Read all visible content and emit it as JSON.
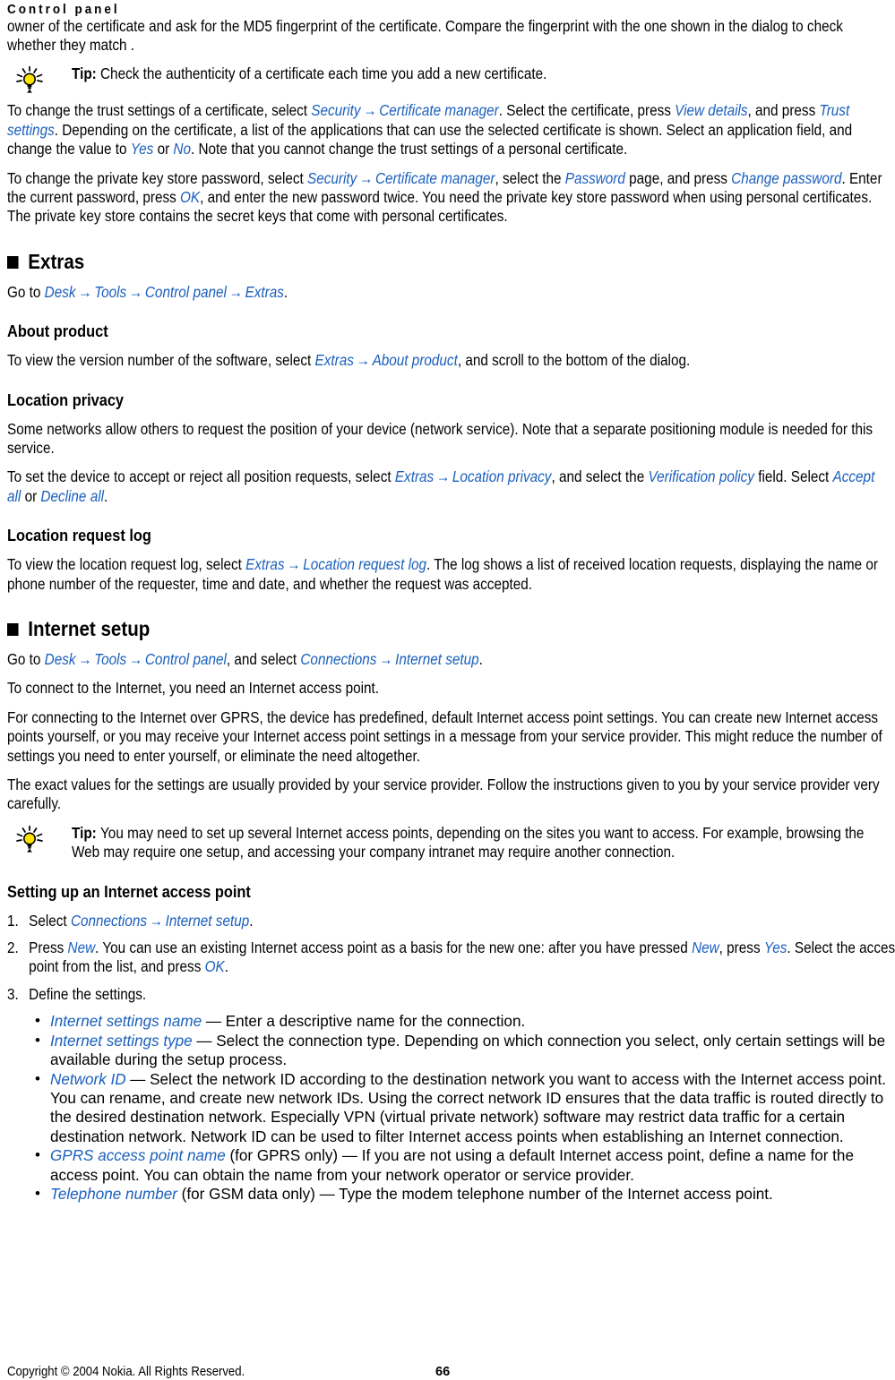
{
  "header": {
    "running_title": "Control panel"
  },
  "icons": {
    "tip_bulb": "lightbulb-icon",
    "section_bullet": "black-square-bullet",
    "arrow": "→",
    "list_bullet": "•"
  },
  "colors": {
    "link_blue": "#1a5fbd",
    "text_black": "#000000",
    "bulb_yellow": "#ffe400",
    "page_background": "#ffffff"
  },
  "content": [
    {
      "id": "para-cert-continued",
      "type": "paragraph",
      "runs": [
        {
          "t": "owner of the certificate and ask for the MD5 fingerprint of the certificate. Compare the fingerprint with the one shown in the dialog to check whether they match ."
        }
      ]
    },
    {
      "id": "tip-certificate-authenticity",
      "type": "tip",
      "label": "Tip:",
      "text": "Check the authenticity of a certificate each time you add a new certificate."
    },
    {
      "id": "para-trust-settings",
      "type": "paragraph",
      "runs": [
        {
          "t": "To change the trust settings of a certificate, select "
        },
        {
          "t": "Security",
          "s": "ui"
        },
        {
          "t": "→",
          "s": "arrow"
        },
        {
          "t": "Certificate manager",
          "s": "ui"
        },
        {
          "t": ". Select the certificate, press "
        },
        {
          "t": "View details",
          "s": "ui"
        },
        {
          "t": ", and press "
        },
        {
          "t": "Trust settings",
          "s": "ui"
        },
        {
          "t": ". Depending on the certificate, a list of the applications that can use the selected certificate is shown. Select an application field, and change the value to "
        },
        {
          "t": "Yes",
          "s": "ui"
        },
        {
          "t": " or "
        },
        {
          "t": "No",
          "s": "ui"
        },
        {
          "t": ". Note that you cannot change the trust settings of a personal certificate."
        }
      ]
    },
    {
      "id": "para-private-key-store",
      "type": "paragraph",
      "runs": [
        {
          "t": "To change the private key store password, select "
        },
        {
          "t": "Security",
          "s": "ui"
        },
        {
          "t": "→",
          "s": "arrow"
        },
        {
          "t": "Certificate manager",
          "s": "ui"
        },
        {
          "t": ", select the "
        },
        {
          "t": "Password",
          "s": "ui"
        },
        {
          "t": " page, and press "
        },
        {
          "t": "Change password",
          "s": "ui"
        },
        {
          "t": ". Enter the current password, press "
        },
        {
          "t": "OK",
          "s": "ui"
        },
        {
          "t": ", and enter the new password twice. You need the private key store password when using personal certificates. The private key store contains the secret keys that come with personal certificates."
        }
      ]
    },
    {
      "id": "heading-extras",
      "type": "section-heading",
      "text": "Extras"
    },
    {
      "id": "para-goto-extras",
      "type": "paragraph",
      "runs": [
        {
          "t": "Go to "
        },
        {
          "t": "Desk",
          "s": "ui"
        },
        {
          "t": "→",
          "s": "arrow"
        },
        {
          "t": "Tools",
          "s": "ui"
        },
        {
          "t": "→",
          "s": "arrow"
        },
        {
          "t": "Control panel",
          "s": "ui"
        },
        {
          "t": "→",
          "s": "arrow"
        },
        {
          "t": "Extras",
          "s": "ui"
        },
        {
          "t": "."
        }
      ]
    },
    {
      "id": "heading-about-product",
      "type": "sub-heading",
      "text": "About product"
    },
    {
      "id": "para-about-product",
      "type": "paragraph",
      "runs": [
        {
          "t": "To view the version number of the software, select "
        },
        {
          "t": "Extras",
          "s": "ui"
        },
        {
          "t": "→",
          "s": "arrow"
        },
        {
          "t": "About product",
          "s": "ui"
        },
        {
          "t": ", and scroll to the bottom of the dialog."
        }
      ]
    },
    {
      "id": "heading-location-privacy",
      "type": "sub-heading",
      "text": "Location privacy"
    },
    {
      "id": "para-location-privacy-intro",
      "type": "paragraph",
      "runs": [
        {
          "t": "Some networks allow others to request the position of your device (network service). Note that a separate positioning module is needed for this service."
        }
      ]
    },
    {
      "id": "para-location-privacy-set",
      "type": "paragraph",
      "runs": [
        {
          "t": "To set the device to accept or reject all position requests, select "
        },
        {
          "t": "Extras",
          "s": "ui"
        },
        {
          "t": "→",
          "s": "arrow"
        },
        {
          "t": "Location privacy",
          "s": "ui"
        },
        {
          "t": ", and select the "
        },
        {
          "t": "Verification policy",
          "s": "ui"
        },
        {
          "t": " field. Select "
        },
        {
          "t": "Accept all",
          "s": "ui"
        },
        {
          "t": " or "
        },
        {
          "t": "Decline all",
          "s": "ui"
        },
        {
          "t": "."
        }
      ]
    },
    {
      "id": "heading-location-request-log",
      "type": "sub-heading",
      "text": "Location request log"
    },
    {
      "id": "para-location-request-log",
      "type": "paragraph",
      "runs": [
        {
          "t": "To view the location request log, select "
        },
        {
          "t": "Extras",
          "s": "ui"
        },
        {
          "t": "→",
          "s": "arrow"
        },
        {
          "t": "Location request log",
          "s": "ui"
        },
        {
          "t": ". The log shows a list of received location requests, displaying the name or phone number of the requester, time and date, and whether the request was accepted."
        }
      ]
    },
    {
      "id": "heading-internet-setup",
      "type": "section-heading",
      "text": "Internet setup"
    },
    {
      "id": "para-goto-internet-setup",
      "type": "paragraph",
      "runs": [
        {
          "t": "Go to "
        },
        {
          "t": "Desk",
          "s": "ui"
        },
        {
          "t": "→",
          "s": "arrow"
        },
        {
          "t": "Tools",
          "s": "ui"
        },
        {
          "t": "→",
          "s": "arrow"
        },
        {
          "t": "Control panel",
          "s": "ui"
        },
        {
          "t": ", and select "
        },
        {
          "t": "Connections",
          "s": "ui"
        },
        {
          "t": "→",
          "s": "arrow"
        },
        {
          "t": "Internet setup",
          "s": "ui"
        },
        {
          "t": "."
        }
      ]
    },
    {
      "id": "para-need-access-point",
      "type": "paragraph",
      "runs": [
        {
          "t": "To connect to the Internet, you need an Internet access point."
        }
      ]
    },
    {
      "id": "para-gprs-predefined",
      "type": "paragraph",
      "runs": [
        {
          "t": "For connecting to the Internet over GPRS, the device has predefined, default Internet access point settings. You can create new Internet access points yourself, or you may receive your Internet access point settings in a message from your service provider. This might reduce the number of settings you need to enter yourself, or eliminate the need altogether."
        }
      ]
    },
    {
      "id": "para-exact-values",
      "type": "paragraph",
      "runs": [
        {
          "t": "The exact values for the settings are usually provided by your service provider. Follow the instructions given to you by your service provider very carefully."
        }
      ]
    },
    {
      "id": "tip-several-access-points",
      "type": "tip",
      "label": "Tip:",
      "text": "You may need to set up several Internet access points, depending on the sites you want to access. For example, browsing the Web may require one setup, and accessing your company intranet may require another connection."
    },
    {
      "id": "heading-setting-up-iap",
      "type": "sub-heading",
      "text": "Setting up an Internet access point"
    }
  ],
  "steps": [
    {
      "id": "step-1",
      "num": "1.",
      "runs": [
        {
          "t": "Select "
        },
        {
          "t": "Connections",
          "s": "ui"
        },
        {
          "t": "→",
          "s": "arrow"
        },
        {
          "t": "Internet setup",
          "s": "ui"
        },
        {
          "t": "."
        }
      ]
    },
    {
      "id": "step-2",
      "num": "2.",
      "runs": [
        {
          "t": "Press "
        },
        {
          "t": "New",
          "s": "ui"
        },
        {
          "t": ". You can use an existing Internet access point as a basis for the new one: after you have pressed "
        },
        {
          "t": "New",
          "s": "ui"
        },
        {
          "t": ", press "
        },
        {
          "t": "Yes",
          "s": "ui"
        },
        {
          "t": ". Select the access point from the list, and press "
        },
        {
          "t": "OK",
          "s": "ui"
        },
        {
          "t": "."
        }
      ]
    },
    {
      "id": "step-3",
      "num": "3.",
      "runs": [
        {
          "t": "Define the settings."
        }
      ]
    }
  ],
  "settings_bullets": [
    {
      "id": "bullet-internet-settings-name",
      "term": "Internet settings name",
      "qualifier": "",
      "desc": " — Enter a descriptive name for the connection."
    },
    {
      "id": "bullet-internet-settings-type",
      "term": "Internet settings type",
      "qualifier": "",
      "desc": " — Select the connection type. Depending on which connection you select, only certain settings will be available during the setup process."
    },
    {
      "id": "bullet-network-id",
      "term": "Network ID",
      "qualifier": "",
      "desc": " — Select the network ID according to the destination network you want to access with the Internet access point. You can rename, and create new network IDs. Using the correct network ID ensures that the data traffic is routed directly to the desired destination network. Especially VPN (virtual private network) software may restrict data traffic for a certain destination network. Network ID can be used to filter Internet access points when establishing an Internet connection."
    },
    {
      "id": "bullet-gprs-access-point-name",
      "term": "GPRS access point name",
      "qualifier": " (for GPRS only)",
      "desc": " — If you are not using a default Internet access point, define a name for the access point. You can obtain the name from your network operator or service provider."
    },
    {
      "id": "bullet-telephone-number",
      "term": "Telephone number",
      "qualifier": " (for GSM data only)",
      "desc": " — Type the modem telephone number of the Internet access point."
    }
  ],
  "footer": {
    "copyright": "Copyright © 2004 Nokia. All Rights Reserved.",
    "page_number": "66"
  }
}
